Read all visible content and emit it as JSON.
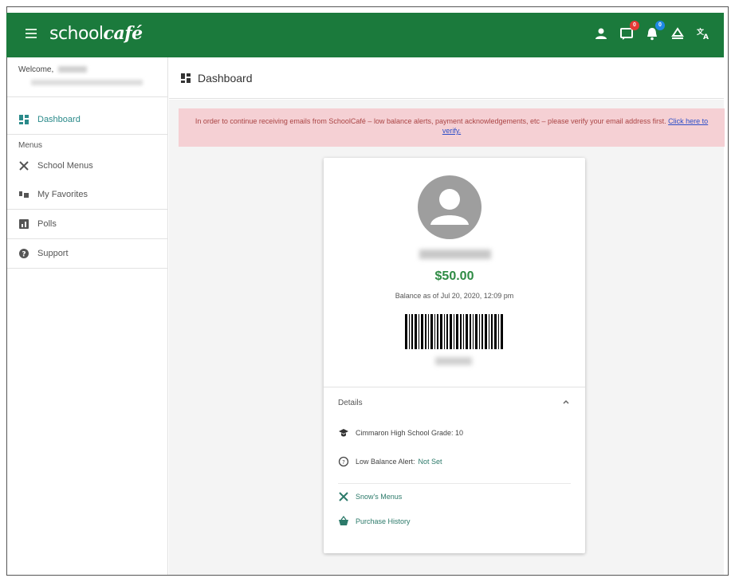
{
  "header": {
    "logo_prefix": "school",
    "logo_brand": "café",
    "icons": [
      "hamburger-menu-icon",
      "account-icon",
      "messages-icon",
      "notifications-icon",
      "accessibility-icon",
      "translate-icon"
    ],
    "messages_badge": "0",
    "notifications_badge": "0"
  },
  "sidebar": {
    "welcome_label": "Welcome,",
    "items": [
      {
        "label": "Dashboard",
        "icon": "dashboard-icon",
        "active": true
      },
      {
        "label": "School Menus",
        "icon": "fork-knife-icon"
      },
      {
        "label": "My Favorites",
        "icon": "favorites-icon"
      },
      {
        "label": "Polls",
        "icon": "poll-icon"
      },
      {
        "label": "Support",
        "icon": "help-icon"
      }
    ],
    "menus_section_label": "Menus"
  },
  "main": {
    "title": "Dashboard"
  },
  "alert": {
    "text": "In order to continue receiving emails from SchoolCafé – low balance alerts, payment acknowledgements, etc – please verify your email address first.",
    "link_text": "Click here to verify."
  },
  "card": {
    "balance": "$50.00",
    "balance_as_of": "Balance as of Jul 20, 2020, 12:09 pm",
    "details_label": "Details",
    "school_grade": "Cimmaron High School Grade: 10",
    "low_balance_label": "Low Balance Alert:",
    "low_balance_value": "Not Set",
    "menus_link": "Snow's Menus",
    "purchase_history_link": "Purchase History"
  },
  "colors": {
    "brand_green": "#1b7a3c",
    "balance_green": "#2e8b44",
    "teal": "#2a8a8a",
    "alert_bg": "#f5d0d4",
    "link_blue": "#2c4ec8"
  }
}
